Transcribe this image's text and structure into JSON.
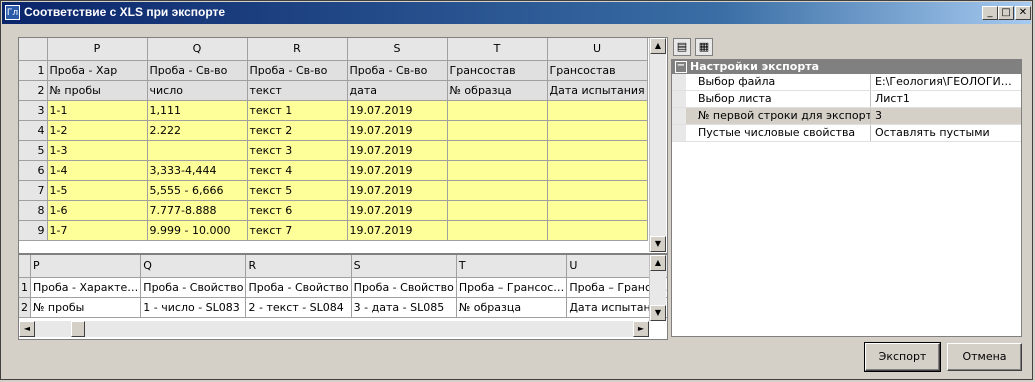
{
  "window": {
    "title": "Соответствие с XLS при экспорте",
    "app_icon": "Гл"
  },
  "top_grid": {
    "columns": [
      "P",
      "Q",
      "R",
      "S",
      "T",
      "U"
    ],
    "rows": [
      {
        "n": "1",
        "cells": [
          "Проба - Хар",
          "Проба - Св-во",
          "Проба - Св-во",
          "Проба - Св-во",
          "Грансостав",
          "Грансостав"
        ],
        "style": "gray"
      },
      {
        "n": "2",
        "cells": [
          "№ пробы",
          "число",
          "текст",
          "дата",
          "№ образца",
          "Дата испытания"
        ],
        "style": "gray"
      },
      {
        "n": "3",
        "cells": [
          "1-1",
          "1,111",
          "текст 1",
          "19.07.2019",
          "",
          ""
        ],
        "style": "yellow"
      },
      {
        "n": "4",
        "cells": [
          "1-2",
          "2.222",
          "текст 2",
          "19.07.2019",
          "",
          ""
        ],
        "style": "yellow"
      },
      {
        "n": "5",
        "cells": [
          "1-3",
          "",
          "текст 3",
          "19.07.2019",
          "",
          ""
        ],
        "style": "yellow"
      },
      {
        "n": "6",
        "cells": [
          "1-4",
          "3,333-4,444",
          "текст 4",
          "19.07.2019",
          "",
          ""
        ],
        "style": "yellow"
      },
      {
        "n": "7",
        "cells": [
          "1-5",
          "5,555 - 6,666",
          "текст 5",
          "19.07.2019",
          "",
          ""
        ],
        "style": "yellow"
      },
      {
        "n": "8",
        "cells": [
          "1-6",
          "7.777-8.888",
          "текст 6",
          "19.07.2019",
          "",
          ""
        ],
        "style": "yellow"
      },
      {
        "n": "9",
        "cells": [
          "1-7",
          "9.999 - 10.000",
          "текст 7",
          "19.07.2019",
          "",
          ""
        ],
        "style": "yellow"
      }
    ]
  },
  "bottom_grid": {
    "columns": [
      "P",
      "Q",
      "R",
      "S",
      "T",
      "U"
    ],
    "rows": [
      {
        "n": "1",
        "cells": [
          "Проба - Характе…",
          "Проба - Свойство",
          "Проба - Свойство",
          "Проба - Свойство",
          "Проба – Грансос…",
          "Проба – Грансос…"
        ]
      },
      {
        "n": "2",
        "cells": [
          "№ пробы",
          "1 - число - SL083",
          "2 - текст - SL084",
          "3 - дата - SL085",
          "№ образца",
          "Дата испытания"
        ]
      }
    ]
  },
  "properties": {
    "category": "Настройки экспорта",
    "items": [
      {
        "key": "Выбор файла",
        "value": "E:\\Геология\\ГЕОЛОГИЯ и..."
      },
      {
        "key": "Выбор листа",
        "value": "Лист1"
      },
      {
        "key": "№ первой строки для экспорта",
        "value": "3"
      },
      {
        "key": "Пустые числовые свойства",
        "value": "Оставлять пустыми"
      }
    ]
  },
  "buttons": {
    "export": "Экспорт",
    "cancel": "Отмена"
  }
}
